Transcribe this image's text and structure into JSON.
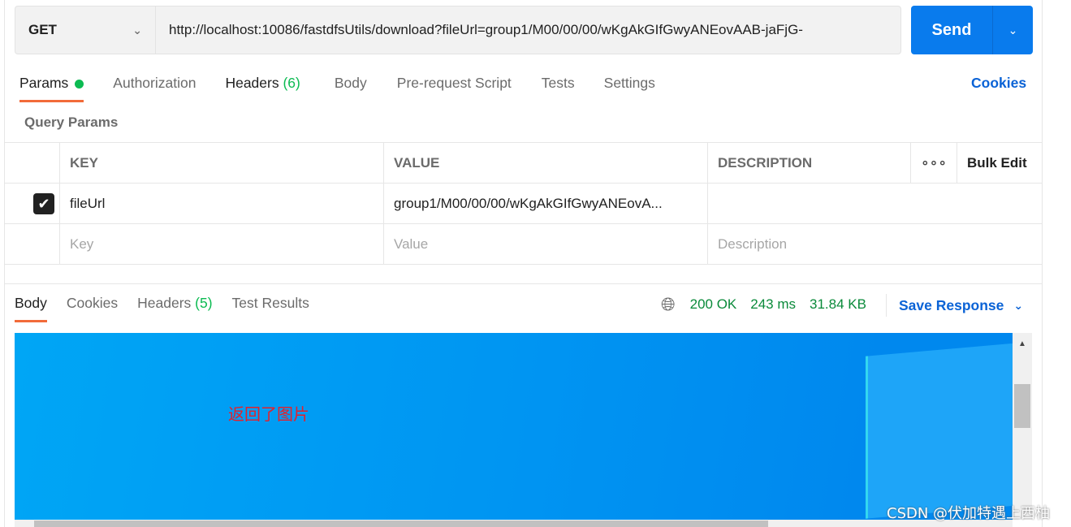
{
  "request": {
    "method": "GET",
    "url": "http://localhost:10086/fastdfsUtils/download?fileUrl=group1/M00/00/00/wKgAkGIfGwyANEovAAB-jaFjG-",
    "send_label": "Send"
  },
  "request_tabs": [
    {
      "label": "Params",
      "active": true
    },
    {
      "label": "Authorization"
    },
    {
      "label": "Headers",
      "count": "(6)"
    },
    {
      "label": "Body"
    },
    {
      "label": "Pre-request Script"
    },
    {
      "label": "Tests"
    },
    {
      "label": "Settings"
    }
  ],
  "cookies_label": "Cookies",
  "query_params": {
    "title": "Query Params",
    "headers": {
      "key": "KEY",
      "value": "VALUE",
      "description": "DESCRIPTION",
      "bulk_edit": "Bulk Edit"
    },
    "rows": [
      {
        "checked": true,
        "key": "fileUrl",
        "value": "group1/M00/00/00/wKgAkGIfGwyANEovA...",
        "description": ""
      }
    ],
    "placeholders": {
      "key": "Key",
      "value": "Value",
      "description": "Description"
    }
  },
  "response_tabs": [
    {
      "label": "Body",
      "active": true
    },
    {
      "label": "Cookies"
    },
    {
      "label": "Headers",
      "count": "(5)"
    },
    {
      "label": "Test Results"
    }
  ],
  "response_status": {
    "status": "200 OK",
    "time": "243 ms",
    "size": "31.84 KB",
    "save_label": "Save Response"
  },
  "annotation": "返回了图片",
  "watermark": "CSDN @伏加特遇上西柚",
  "colors": {
    "accent": "#097bed",
    "tab_underline": "#f26b3a",
    "success": "#0cbb52"
  }
}
